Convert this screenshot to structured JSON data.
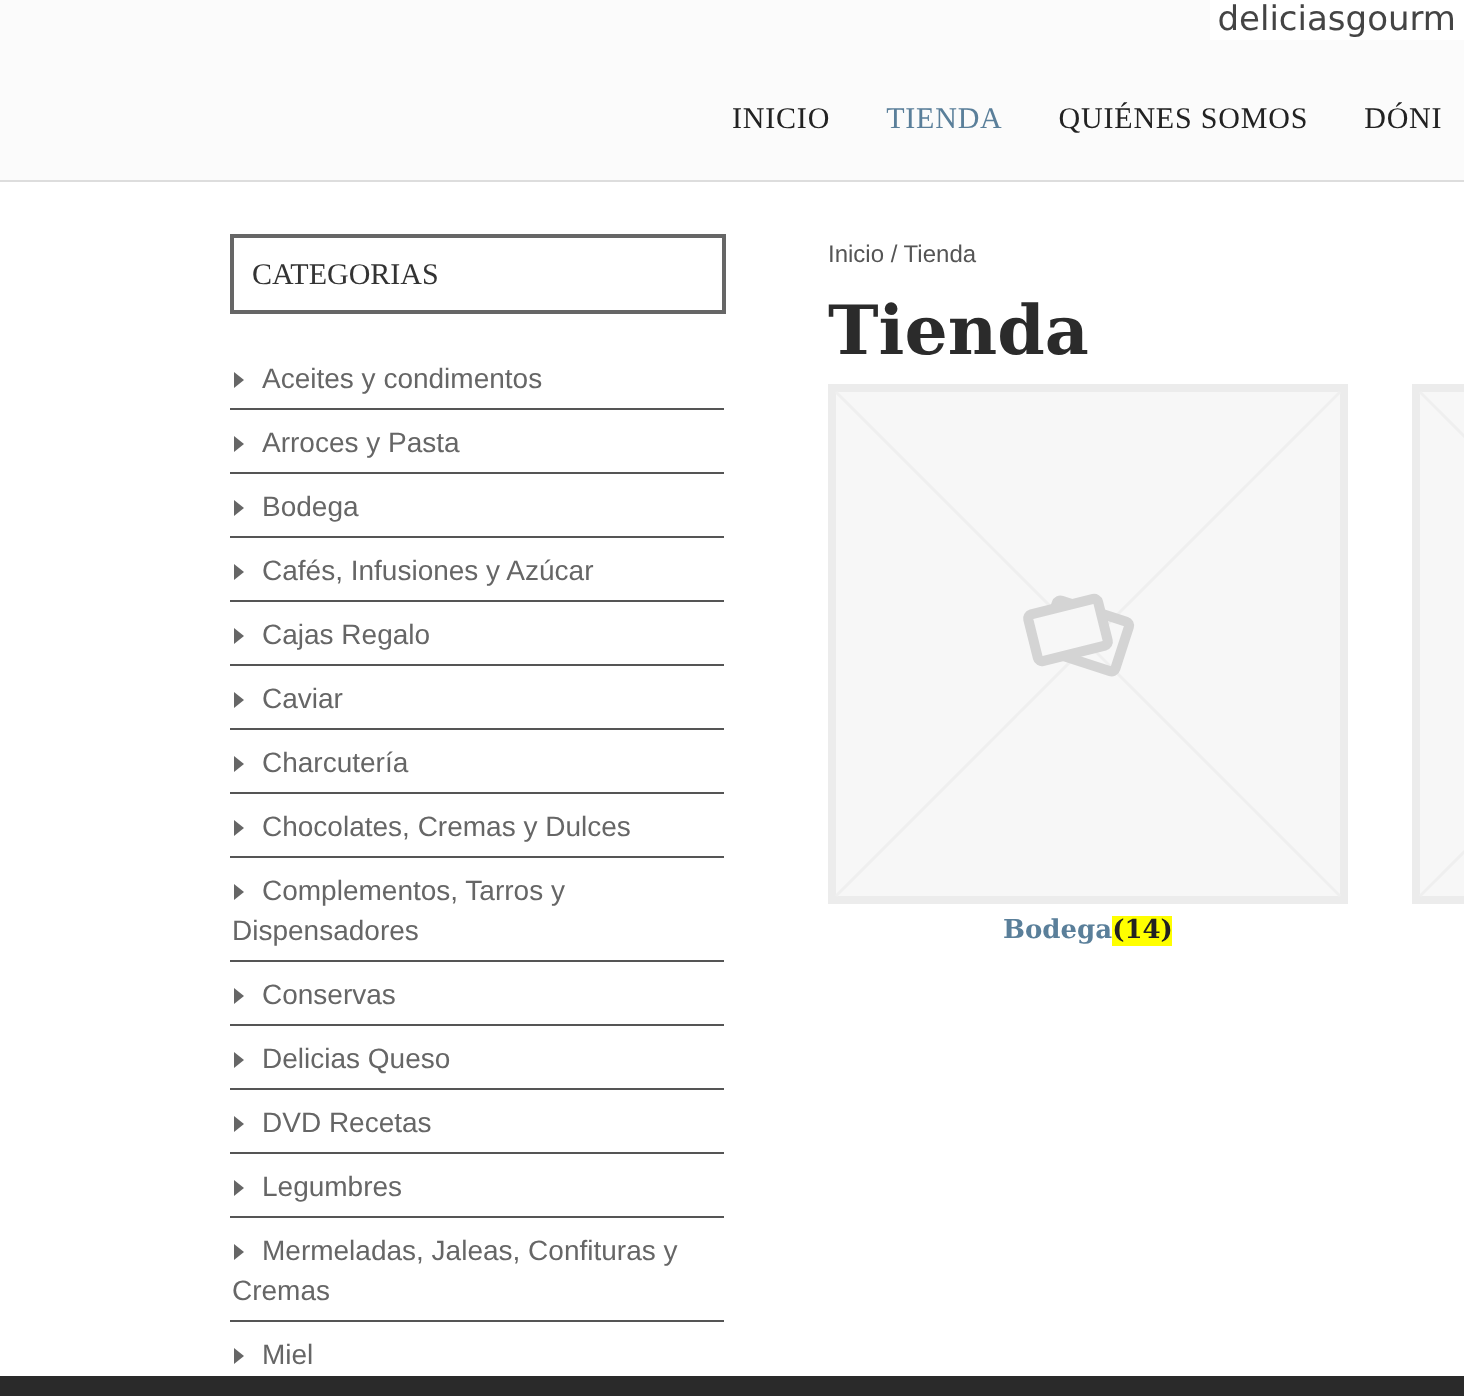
{
  "logo": "deliciasgourm",
  "nav": [
    {
      "label": "INICIO",
      "selected": false
    },
    {
      "label": "TIENDA",
      "selected": true
    },
    {
      "label": "QUIÉNES SOMOS",
      "selected": false
    },
    {
      "label": "DÓNI",
      "selected": false
    }
  ],
  "sidebar": {
    "title": "CATEGORIAS",
    "items": [
      "Aceites y condimentos",
      "Arroces y Pasta",
      "Bodega",
      "Cafés, Infusiones y Azúcar",
      "Cajas Regalo",
      "Caviar",
      "Charcutería",
      "Chocolates, Cremas y Dulces",
      "Complementos, Tarros y Dispensadores",
      "Conservas",
      "Delicias Queso",
      "DVD Recetas",
      "Legumbres",
      "Mermeladas, Jaleas, Confituras y Cremas",
      "Miel"
    ]
  },
  "breadcrumb": "Inicio / Tienda",
  "heading": "Tienda",
  "products": [
    {
      "kind": "category",
      "name": "Bodega",
      "count": "(14)"
    },
    {
      "kind": "picture"
    }
  ]
}
